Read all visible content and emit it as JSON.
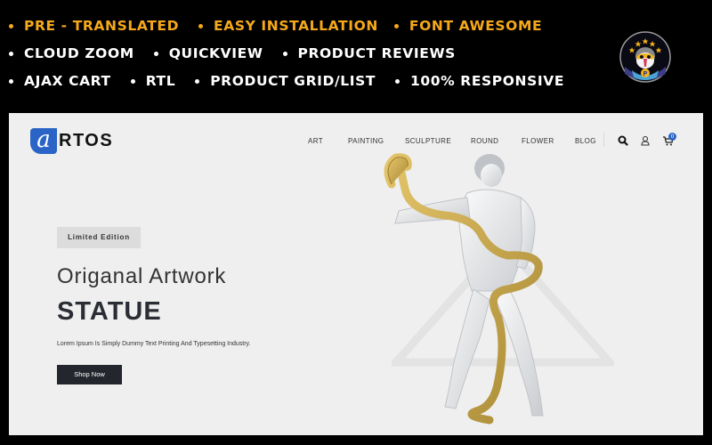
{
  "features": {
    "row1": [
      "PRE - TRANSLATED",
      "EASY INSTALLATION",
      "FONT AWESOME"
    ],
    "row2": [
      "CLOUD ZOOM",
      "QUICKVIEW",
      "PRODUCT REVIEWS"
    ],
    "row3": [
      "AJAX CART",
      "RTL",
      "PRODUCT GRID/LIST",
      "100% RESPONSIVE"
    ],
    "highlight_color": "#f5a91a"
  },
  "badge": {
    "icon": "prestashop-puffin-badge",
    "letter": "P"
  },
  "site": {
    "logo": {
      "mark": "a",
      "text": "RTOS"
    },
    "nav": [
      "ART",
      "PAINTING",
      "SCULPTURE",
      "ROUND",
      "FLOWER",
      "BLOG"
    ],
    "cart_count": "0",
    "accent_color": "#2a64c6"
  },
  "hero": {
    "tag": "Limited Edition",
    "subtitle": "Origanal Artwork",
    "title": "STATUE",
    "description": "Lorem Ipsum Is Simply Dummy Text Printing And Typesetting Industry.",
    "button": "Shop Now",
    "image": "statue-with-golden-snake"
  }
}
